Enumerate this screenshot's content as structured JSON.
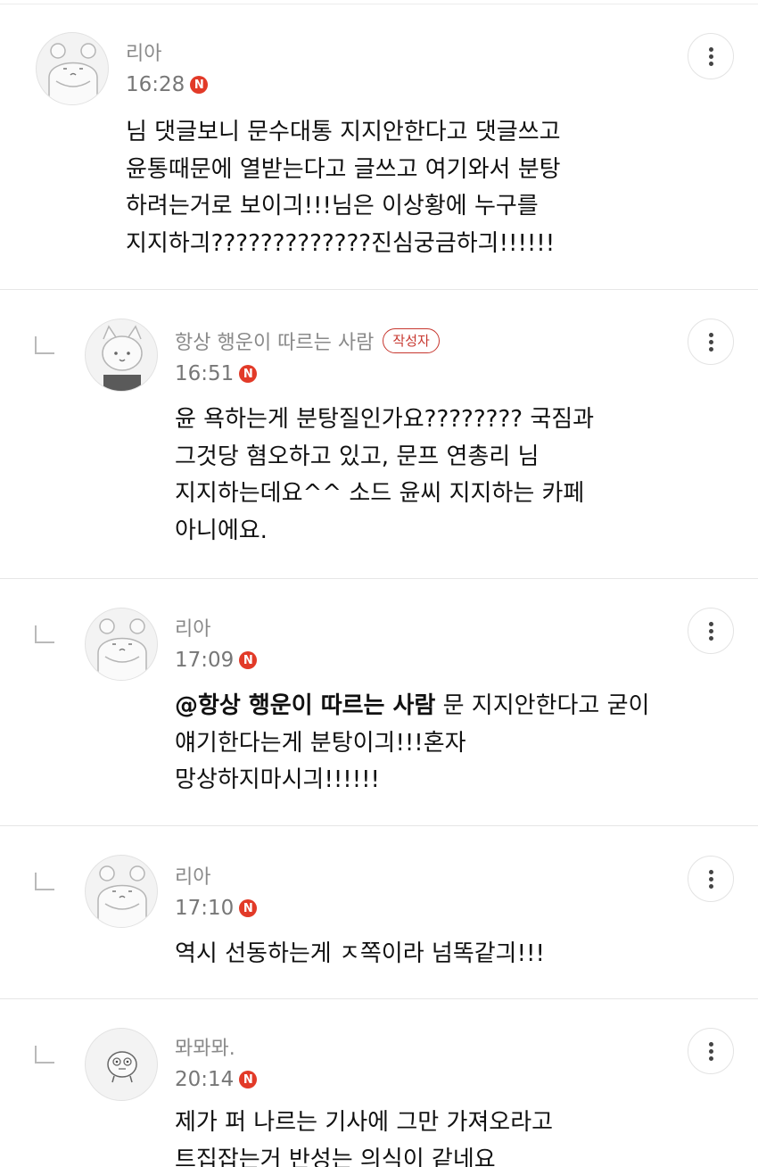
{
  "comments": [
    {
      "author": "리아",
      "time": "16:28",
      "new_badge": "N",
      "text": "님 댓글보니 문수대통 지지안한다고 댓글쓰고\n윤통때문에 열받는다고 글쓰고 여기와서 분탕\n하려는거로 보이긔!!!님은 이상황에 누구를\n지지하긔?????????????진심궁금하긔!!!!!!",
      "avatar_icon": "hamster-avatar-icon"
    },
    {
      "author": "항상 행운이 따르는 사람",
      "author_badge": "작성자",
      "time": "16:51",
      "new_badge": "N",
      "text": "윤 욕하는게 분탕질인가요???????? 국짐과\n그것당 혐오하고 있고, 문프 연총리 님\n지지하는데요^^ 소드 윤씨 지지하는 카페\n아니에요.",
      "avatar_icon": "cat-avatar-icon"
    },
    {
      "author": "리아",
      "time": "17:09",
      "new_badge": "N",
      "mention": "@항상 행운이 따르는 사람",
      "text": " 문 지지안한다고 굳이\n얘기한다는게 분탕이긔!!!혼자\n망상하지마시긔!!!!!!",
      "avatar_icon": "hamster-avatar-icon"
    },
    {
      "author": "리아",
      "time": "17:10",
      "new_badge": "N",
      "text": "역시 선동하는게 ㅈ쪽이라 넘똑같긔!!!",
      "avatar_icon": "hamster-avatar-icon"
    },
    {
      "author": "뫄뫄뫄.",
      "time": "20:14",
      "new_badge": "N",
      "text": "제가 퍼 나르는 기사에 그만 가져오라고\n트집잡는거 반성는 의식이 같네요",
      "avatar_icon": "character-avatar-icon"
    }
  ]
}
